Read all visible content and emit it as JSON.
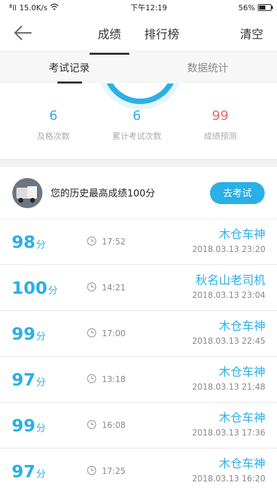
{
  "status": {
    "signal": "ᅨll",
    "speed": "15.0K/s",
    "time": "下午12:19",
    "battery": "56%",
    "battery_fraction": 0.56
  },
  "nav": {
    "tabs": [
      "成绩",
      "排行榜"
    ],
    "clear": "清空"
  },
  "subtabs": [
    "考试记录",
    "数据统计"
  ],
  "stats": [
    {
      "value": "6",
      "label": "及格次数",
      "color": "#2ab0e6"
    },
    {
      "value": "6",
      "label": "累计考试次数",
      "color": "#2ab0e6"
    },
    {
      "value": "99",
      "label": "成绩预测",
      "color": "#e46b6b"
    }
  ],
  "best": {
    "text": "您的历史最高成绩100分",
    "button": "去考试"
  },
  "records": [
    {
      "score": "98",
      "unit": "分",
      "duration": "17:52",
      "name": "木仓车神",
      "date": "2018.03.13  23:20"
    },
    {
      "score": "100",
      "unit": "分",
      "duration": "14:21",
      "name": "秋名山老司机",
      "date": "2018.03.13  23:04"
    },
    {
      "score": "99",
      "unit": "分",
      "duration": "17:00",
      "name": "木仓车神",
      "date": "2018.03.13  22:45"
    },
    {
      "score": "97",
      "unit": "分",
      "duration": "13:18",
      "name": "木仓车神",
      "date": "2018.03.13  21:48"
    },
    {
      "score": "99",
      "unit": "分",
      "duration": "16:08",
      "name": "木仓车神",
      "date": "2018.03.13  17:36"
    },
    {
      "score": "97",
      "unit": "分",
      "duration": "17:25",
      "name": "木仓车神",
      "date": "2018.03.13  16:20"
    }
  ]
}
